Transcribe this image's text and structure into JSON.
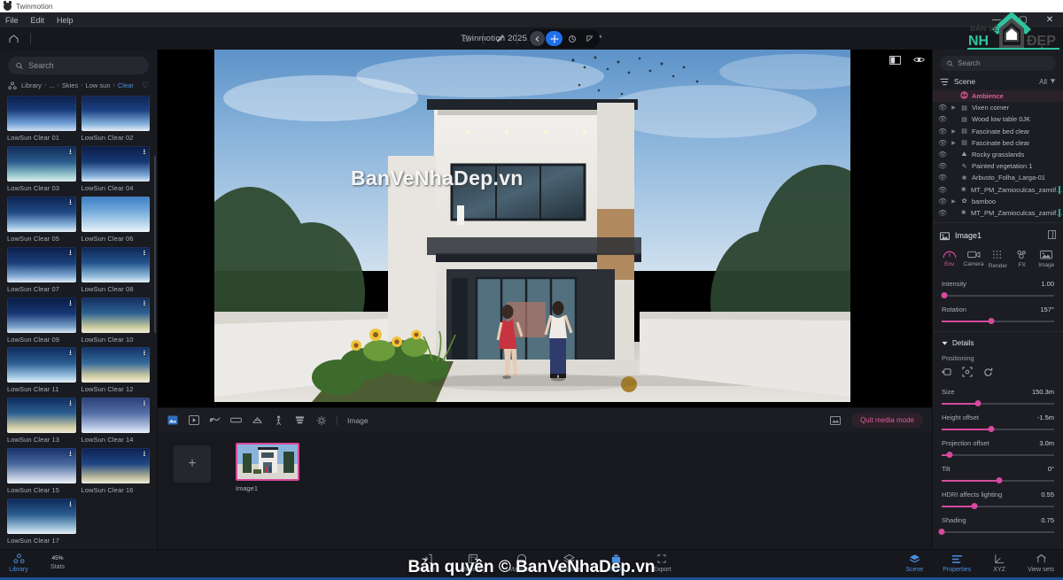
{
  "os": {
    "app_name": "Twinmotion",
    "minimize": "—",
    "maximize": "▢",
    "close": "✕"
  },
  "menu": {
    "items": [
      "File",
      "Edit",
      "Help"
    ]
  },
  "toolbar": {
    "document_title": "Twinmotion 2025.1  ·  NHA HIEN OK*",
    "home_icon": "home-icon",
    "layers_icon": "layers-icon",
    "eyedropper_icon": "eyedropper-icon",
    "gizmo": [
      {
        "name": "back",
        "label": "←",
        "active": false
      },
      {
        "name": "move",
        "label": "✛",
        "active": true
      },
      {
        "name": "rotate",
        "label": "◎",
        "active": false
      },
      {
        "name": "scale",
        "label": "⤢",
        "active": false
      }
    ]
  },
  "brand": {
    "line1": "BẢN VẼ",
    "line2": "NH",
    "line3": "ĐẸP",
    "accent": "#2ec4a0"
  },
  "library": {
    "search_placeholder": "Search",
    "breadcrumb": [
      "Library",
      "...",
      "Skies",
      "Low sun",
      "Clear"
    ],
    "breadcrumb_current": "Clear",
    "favorite_icon": "heart-icon",
    "items": [
      {
        "label": "LowSun Clear 01",
        "download": false,
        "g": "linear-gradient(180deg,#0d1f4a 0%,#173a7a 40%,#6f9fd6 78%,#cfe0f2 100%)"
      },
      {
        "label": "LowSun Clear 02",
        "download": false,
        "g": "linear-gradient(180deg,#0f2350 0%,#1c4284 42%,#84b1dc 80%,#e6eff8 100%)"
      },
      {
        "label": "LowSun Clear 03",
        "download": true,
        "g": "linear-gradient(180deg,#102a55 0%,#2a5d8f 45%,#93c4cb 80%,#d9ecee 100%)"
      },
      {
        "label": "LowSun Clear 04",
        "download": true,
        "g": "linear-gradient(180deg,#0b1c45 0%,#173a76 45%,#7aa8d4 82%,#dbe8f5 100%)"
      },
      {
        "label": "LowSun Clear 05",
        "download": true,
        "g": "linear-gradient(180deg,#0d2350 0%,#1f4a86 45%,#8fb8dd 82%,#e3eef8 100%)"
      },
      {
        "label": "LowSun Clear 06",
        "download": false,
        "g": "linear-gradient(180deg,#3b7ec4 0%,#72a9da 40%,#bcd8ee 78%,#eef5fb 100%)"
      },
      {
        "label": "LowSun Clear 07",
        "download": true,
        "g": "linear-gradient(180deg,#0c1e48 0%,#1a3f7c 45%,#7fa9d2 82%,#dde9f5 100%)"
      },
      {
        "label": "LowSun Clear 08",
        "download": true,
        "g": "linear-gradient(180deg,#0e2552 0%,#23548e 45%,#8fbad9 82%,#e2eef7 100%)"
      },
      {
        "label": "LowSun Clear 09",
        "download": true,
        "g": "linear-gradient(180deg,#0a1b42 0%,#163775 45%,#799fc9 82%,#dae7f3 100%)"
      },
      {
        "label": "LowSun Clear 10",
        "download": true,
        "g": "linear-gradient(180deg,#112c5c 0%,#2f6392 45%,#c4c79b 82%,#f0ecd8 100%)"
      },
      {
        "label": "LowSun Clear 11",
        "download": true,
        "g": "linear-gradient(180deg,#0f2a5c 0%,#2a5d92 45%,#9cc3e0 82%,#e6f0f8 100%)"
      },
      {
        "label": "LowSun Clear 12",
        "download": true,
        "g": "linear-gradient(180deg,#123065 0%,#35699a 45%,#cfcca3 82%,#f3eedd 100%)"
      },
      {
        "label": "LowSun Clear 13",
        "download": true,
        "g": "linear-gradient(180deg,#0f2a5c 0%,#2e6193 45%,#cdc9a0 82%,#f1ecd9 100%)"
      },
      {
        "label": "LowSun Clear 14",
        "download": true,
        "g": "linear-gradient(180deg,#2a3f78 0%,#5570a8 45%,#b2c3e0 82%,#e9effa 100%)"
      },
      {
        "label": "LowSun Clear 15",
        "download": true,
        "g": "linear-gradient(180deg,#16306a 0%,#48699e 45%,#b9c6de 82%,#ecf1f9 100%)"
      },
      {
        "label": "LowSun Clear 16",
        "download": true,
        "g": "linear-gradient(180deg,#0c2050 0%,#1e4784 45%,#b9b898 82%,#eeecd9 100%)"
      },
      {
        "label": "LowSun Clear 17",
        "download": true,
        "g": "linear-gradient(180deg,#0d2856 0%,#2a5d90 45%,#9ec1d9 82%,#e5eff7 100%)"
      }
    ]
  },
  "viewport": {
    "watermark": "BanVeNhaDep.vn",
    "panel_toggle_icon": "panel-toggle-icon",
    "visibility_icon": "eye-icon"
  },
  "media_bar": {
    "icons": [
      "image-media-icon",
      "video-media-icon",
      "panorama-media-icon",
      "presentation-icon",
      "phasing-icon",
      "walkthrough-icon",
      "bim-icon",
      "vr-icon"
    ],
    "active_icon_index": 0,
    "label": "Image",
    "export_icon": "export-preview-icon",
    "quit_label": "Quit media mode"
  },
  "media_tray": {
    "add_label": "+",
    "items": [
      {
        "name": "Image1"
      }
    ]
  },
  "scene": {
    "search_placeholder": "Search",
    "panel_title": "Scene",
    "filter_label": "All",
    "menu_icon": "hamburger-icon",
    "filter_icon": "funnel-icon",
    "items": [
      {
        "label": "Ambience",
        "selected": true,
        "expand": false,
        "eye": false,
        "icon": "ambience-icon",
        "indent": 0,
        "bar": false
      },
      {
        "label": "Vixen corner",
        "selected": false,
        "expand": true,
        "eye": true,
        "icon": "object-icon",
        "indent": 1,
        "bar": false
      },
      {
        "label": "Wood low table 0JK",
        "selected": false,
        "expand": false,
        "eye": true,
        "icon": "object-icon",
        "indent": 1,
        "bar": false
      },
      {
        "label": "Fascinate bed clear",
        "selected": false,
        "expand": true,
        "eye": true,
        "icon": "object-icon",
        "indent": 1,
        "bar": false
      },
      {
        "label": "Fascinate bed clear",
        "selected": false,
        "expand": true,
        "eye": true,
        "icon": "object-icon",
        "indent": 1,
        "bar": false
      },
      {
        "label": "Rocky grasslands",
        "selected": false,
        "expand": false,
        "eye": true,
        "icon": "terrain-icon",
        "indent": 1,
        "bar": false
      },
      {
        "label": "Painted vegetation 1",
        "selected": false,
        "expand": false,
        "eye": true,
        "icon": "brush-icon",
        "indent": 1,
        "bar": false
      },
      {
        "label": "Arbusto_Folha_Larga-01",
        "selected": false,
        "expand": false,
        "eye": true,
        "icon": "plant-icon",
        "indent": 1,
        "bar": false
      },
      {
        "label": "MT_PM_Zamioculcas_zamiifoli…",
        "selected": false,
        "expand": false,
        "eye": true,
        "icon": "plant-icon",
        "indent": 1,
        "bar": true
      },
      {
        "label": "bamboo",
        "selected": false,
        "expand": true,
        "eye": true,
        "icon": "plant-group-icon",
        "indent": 1,
        "bar": false
      },
      {
        "label": "MT_PM_Zamioculcas_zamiifoli…",
        "selected": false,
        "expand": false,
        "eye": true,
        "icon": "plant-icon",
        "indent": 1,
        "bar": true
      }
    ]
  },
  "properties": {
    "object_name": "Image1",
    "object_icon": "media-image-icon",
    "dock_icon": "dock-panel-icon",
    "tabs": [
      {
        "label": "Env",
        "icon": "dome-icon",
        "active": true
      },
      {
        "label": "Camera",
        "icon": "camera-icon",
        "active": false
      },
      {
        "label": "Render",
        "icon": "render-dots-icon",
        "active": false
      },
      {
        "label": "FX",
        "icon": "fx-icon",
        "active": false
      },
      {
        "label": "Image",
        "icon": "image-icon",
        "active": false
      }
    ],
    "sliders_top": [
      {
        "label": "Intensity",
        "value": "1.00",
        "pct": 2
      },
      {
        "label": "Rotation",
        "value": "157°",
        "pct": 44
      }
    ],
    "details_label": "Details",
    "positioning_label": "Positioning",
    "positioning_icons": [
      "move-projection-icon",
      "fit-icon",
      "reset-rotation-icon"
    ],
    "sliders_details": [
      {
        "label": "Size",
        "value": "150.3m",
        "pct": 32
      },
      {
        "label": "Height offset",
        "value": "-1.5m",
        "pct": 44
      },
      {
        "label": "Projection offset",
        "value": "3.0m",
        "pct": 7
      },
      {
        "label": "Tilt",
        "value": "0°",
        "pct": 51
      },
      {
        "label": "HDRI affects lighting",
        "value": "0.55",
        "pct": 29
      },
      {
        "label": "Shading",
        "value": "0.75",
        "pct": 0
      }
    ]
  },
  "bottom": {
    "left": [
      {
        "label": "Library",
        "icon": "library-icon",
        "active": true
      },
      {
        "label": "Stats",
        "icon": "45",
        "suffix": "%",
        "active": false,
        "is_stat": true
      }
    ],
    "center": [
      {
        "label": "Import",
        "icon": "import-icon",
        "active": false
      },
      {
        "label": "Modeling",
        "icon": "modeling-icon",
        "active": false
      },
      {
        "label": "Materials",
        "icon": "materials-icon",
        "active": false
      },
      {
        "label": "Populate",
        "icon": "populate-icon",
        "active": false
      },
      {
        "label": "Media",
        "icon": "media-icon",
        "active": true
      },
      {
        "label": "Export",
        "icon": "export-icon",
        "active": false
      }
    ],
    "right": [
      {
        "label": "Scene",
        "icon": "scene-stack-icon",
        "active": true
      },
      {
        "label": "Properties",
        "icon": "properties-icon",
        "active": true
      },
      {
        "label": "XYZ",
        "icon": "axis-icon",
        "active": false
      },
      {
        "label": "View sets",
        "icon": "viewsets-icon",
        "active": false
      }
    ]
  },
  "overlay": {
    "copyright": "Bản quyền © BanVeNhaDep.vn"
  }
}
